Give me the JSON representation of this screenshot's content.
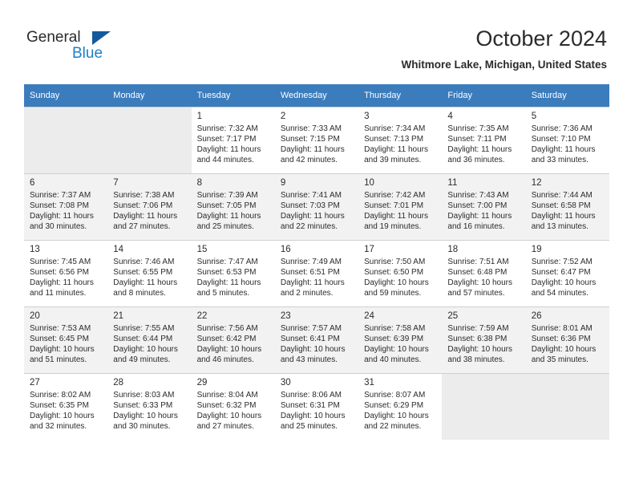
{
  "brand": {
    "name_part1": "General",
    "name_part2": "Blue",
    "logo_icon": "triangle-flag-icon",
    "accent_color": "#1f7ec4",
    "triangle_color": "#15599c"
  },
  "header": {
    "title": "October 2024",
    "location": "Whitmore Lake, Michigan, United States"
  },
  "calendar": {
    "header_bg": "#3b7cbd",
    "weekday_headers": [
      "Sunday",
      "Monday",
      "Tuesday",
      "Wednesday",
      "Thursday",
      "Friday",
      "Saturday"
    ],
    "labels": {
      "sunrise": "Sunrise:",
      "sunset": "Sunset:",
      "daylight": "Daylight:"
    },
    "weeks": [
      [
        {
          "day": "",
          "empty": true
        },
        {
          "day": "",
          "empty": true
        },
        {
          "day": "1",
          "sunrise": "Sunrise: 7:32 AM",
          "sunset": "Sunset: 7:17 PM",
          "daylight": "Daylight: 11 hours and 44 minutes."
        },
        {
          "day": "2",
          "sunrise": "Sunrise: 7:33 AM",
          "sunset": "Sunset: 7:15 PM",
          "daylight": "Daylight: 11 hours and 42 minutes."
        },
        {
          "day": "3",
          "sunrise": "Sunrise: 7:34 AM",
          "sunset": "Sunset: 7:13 PM",
          "daylight": "Daylight: 11 hours and 39 minutes."
        },
        {
          "day": "4",
          "sunrise": "Sunrise: 7:35 AM",
          "sunset": "Sunset: 7:11 PM",
          "daylight": "Daylight: 11 hours and 36 minutes."
        },
        {
          "day": "5",
          "sunrise": "Sunrise: 7:36 AM",
          "sunset": "Sunset: 7:10 PM",
          "daylight": "Daylight: 11 hours and 33 minutes."
        }
      ],
      [
        {
          "day": "6",
          "sunrise": "Sunrise: 7:37 AM",
          "sunset": "Sunset: 7:08 PM",
          "daylight": "Daylight: 11 hours and 30 minutes."
        },
        {
          "day": "7",
          "sunrise": "Sunrise: 7:38 AM",
          "sunset": "Sunset: 7:06 PM",
          "daylight": "Daylight: 11 hours and 27 minutes."
        },
        {
          "day": "8",
          "sunrise": "Sunrise: 7:39 AM",
          "sunset": "Sunset: 7:05 PM",
          "daylight": "Daylight: 11 hours and 25 minutes."
        },
        {
          "day": "9",
          "sunrise": "Sunrise: 7:41 AM",
          "sunset": "Sunset: 7:03 PM",
          "daylight": "Daylight: 11 hours and 22 minutes."
        },
        {
          "day": "10",
          "sunrise": "Sunrise: 7:42 AM",
          "sunset": "Sunset: 7:01 PM",
          "daylight": "Daylight: 11 hours and 19 minutes."
        },
        {
          "day": "11",
          "sunrise": "Sunrise: 7:43 AM",
          "sunset": "Sunset: 7:00 PM",
          "daylight": "Daylight: 11 hours and 16 minutes."
        },
        {
          "day": "12",
          "sunrise": "Sunrise: 7:44 AM",
          "sunset": "Sunset: 6:58 PM",
          "daylight": "Daylight: 11 hours and 13 minutes."
        }
      ],
      [
        {
          "day": "13",
          "sunrise": "Sunrise: 7:45 AM",
          "sunset": "Sunset: 6:56 PM",
          "daylight": "Daylight: 11 hours and 11 minutes."
        },
        {
          "day": "14",
          "sunrise": "Sunrise: 7:46 AM",
          "sunset": "Sunset: 6:55 PM",
          "daylight": "Daylight: 11 hours and 8 minutes."
        },
        {
          "day": "15",
          "sunrise": "Sunrise: 7:47 AM",
          "sunset": "Sunset: 6:53 PM",
          "daylight": "Daylight: 11 hours and 5 minutes."
        },
        {
          "day": "16",
          "sunrise": "Sunrise: 7:49 AM",
          "sunset": "Sunset: 6:51 PM",
          "daylight": "Daylight: 11 hours and 2 minutes."
        },
        {
          "day": "17",
          "sunrise": "Sunrise: 7:50 AM",
          "sunset": "Sunset: 6:50 PM",
          "daylight": "Daylight: 10 hours and 59 minutes."
        },
        {
          "day": "18",
          "sunrise": "Sunrise: 7:51 AM",
          "sunset": "Sunset: 6:48 PM",
          "daylight": "Daylight: 10 hours and 57 minutes."
        },
        {
          "day": "19",
          "sunrise": "Sunrise: 7:52 AM",
          "sunset": "Sunset: 6:47 PM",
          "daylight": "Daylight: 10 hours and 54 minutes."
        }
      ],
      [
        {
          "day": "20",
          "sunrise": "Sunrise: 7:53 AM",
          "sunset": "Sunset: 6:45 PM",
          "daylight": "Daylight: 10 hours and 51 minutes."
        },
        {
          "day": "21",
          "sunrise": "Sunrise: 7:55 AM",
          "sunset": "Sunset: 6:44 PM",
          "daylight": "Daylight: 10 hours and 49 minutes."
        },
        {
          "day": "22",
          "sunrise": "Sunrise: 7:56 AM",
          "sunset": "Sunset: 6:42 PM",
          "daylight": "Daylight: 10 hours and 46 minutes."
        },
        {
          "day": "23",
          "sunrise": "Sunrise: 7:57 AM",
          "sunset": "Sunset: 6:41 PM",
          "daylight": "Daylight: 10 hours and 43 minutes."
        },
        {
          "day": "24",
          "sunrise": "Sunrise: 7:58 AM",
          "sunset": "Sunset: 6:39 PM",
          "daylight": "Daylight: 10 hours and 40 minutes."
        },
        {
          "day": "25",
          "sunrise": "Sunrise: 7:59 AM",
          "sunset": "Sunset: 6:38 PM",
          "daylight": "Daylight: 10 hours and 38 minutes."
        },
        {
          "day": "26",
          "sunrise": "Sunrise: 8:01 AM",
          "sunset": "Sunset: 6:36 PM",
          "daylight": "Daylight: 10 hours and 35 minutes."
        }
      ],
      [
        {
          "day": "27",
          "sunrise": "Sunrise: 8:02 AM",
          "sunset": "Sunset: 6:35 PM",
          "daylight": "Daylight: 10 hours and 32 minutes."
        },
        {
          "day": "28",
          "sunrise": "Sunrise: 8:03 AM",
          "sunset": "Sunset: 6:33 PM",
          "daylight": "Daylight: 10 hours and 30 minutes."
        },
        {
          "day": "29",
          "sunrise": "Sunrise: 8:04 AM",
          "sunset": "Sunset: 6:32 PM",
          "daylight": "Daylight: 10 hours and 27 minutes."
        },
        {
          "day": "30",
          "sunrise": "Sunrise: 8:06 AM",
          "sunset": "Sunset: 6:31 PM",
          "daylight": "Daylight: 10 hours and 25 minutes."
        },
        {
          "day": "31",
          "sunrise": "Sunrise: 8:07 AM",
          "sunset": "Sunset: 6:29 PM",
          "daylight": "Daylight: 10 hours and 22 minutes."
        },
        {
          "day": "",
          "empty": true
        },
        {
          "day": "",
          "empty": true
        }
      ]
    ]
  }
}
